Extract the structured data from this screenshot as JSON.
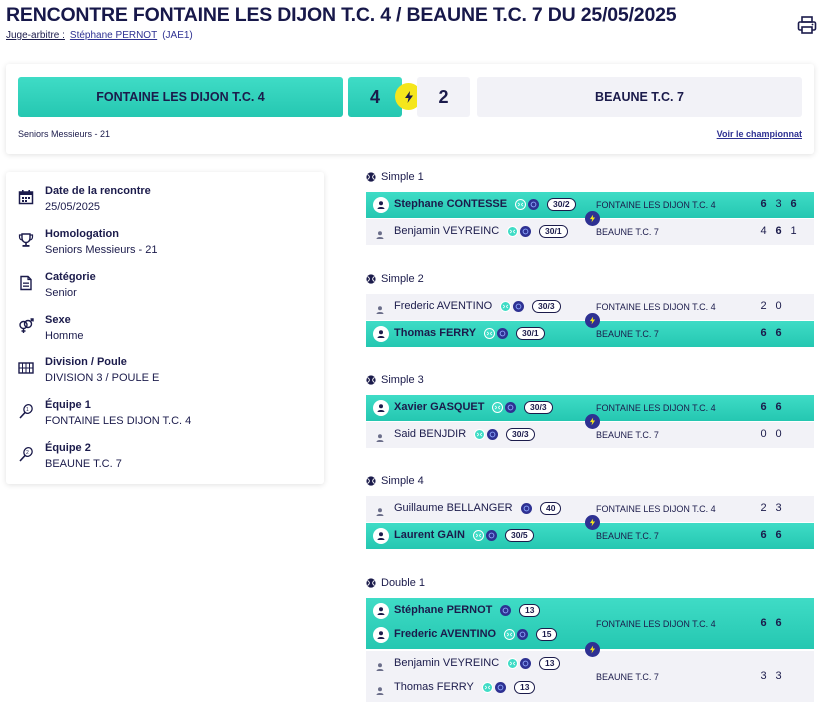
{
  "title": "RENCONTRE FONTAINE LES DIJON T.C. 4 / BEAUNE T.C. 7 DU 25/05/2025",
  "referee": {
    "label": "Juge-arbitre :",
    "name": "Stéphane PERNOT",
    "code": "(JAE1)"
  },
  "scoreboard": {
    "home_team": "FONTAINE LES DIJON T.C. 4",
    "away_team": "BEAUNE T.C. 7",
    "home_score": "4",
    "away_score": "2",
    "category": "Seniors Messieurs - 21",
    "championship_link": "Voir le championnat"
  },
  "info": [
    {
      "label": "Date de la rencontre",
      "value": "25/05/2025",
      "icon": "calendar-icon"
    },
    {
      "label": "Homologation",
      "value": "Seniors Messieurs - 21",
      "icon": "trophy-icon"
    },
    {
      "label": "Catégorie",
      "value": "Senior",
      "icon": "document-icon"
    },
    {
      "label": "Sexe",
      "value": "Homme",
      "icon": "gender-icon"
    },
    {
      "label": "Division / Poule",
      "value": "DIVISION 3 / POULE E",
      "icon": "grid-icon"
    },
    {
      "label": "Équipe 1",
      "value": "FONTAINE LES DIJON T.C. 4",
      "icon": "racket-1-icon"
    },
    {
      "label": "Équipe 2",
      "value": "BEAUNE T.C. 7",
      "icon": "racket-2-icon"
    }
  ],
  "matches": [
    {
      "title": "Simple 1",
      "rows": [
        {
          "winner": true,
          "players": [
            {
              "name": "Stephane CONTESSE",
              "rank": "30/2",
              "teal": true
            }
          ],
          "team": "FONTAINE LES DIJON T.C. 4",
          "sets": [
            {
              "v": "6",
              "w": true
            },
            {
              "v": "3",
              "w": false
            },
            {
              "v": "6",
              "w": true
            }
          ]
        },
        {
          "winner": false,
          "players": [
            {
              "name": "Benjamin VEYREINC",
              "rank": "30/1",
              "teal": true
            }
          ],
          "team": "BEAUNE T.C. 7",
          "sets": [
            {
              "v": "4",
              "w": false
            },
            {
              "v": "6",
              "w": true
            },
            {
              "v": "1",
              "w": false
            }
          ]
        }
      ]
    },
    {
      "title": "Simple 2",
      "rows": [
        {
          "winner": false,
          "players": [
            {
              "name": "Frederic AVENTINO",
              "rank": "30/3",
              "teal": true
            }
          ],
          "team": "FONTAINE LES DIJON T.C. 4",
          "sets": [
            {
              "v": "2",
              "w": false
            },
            {
              "v": "0",
              "w": false
            }
          ]
        },
        {
          "winner": true,
          "players": [
            {
              "name": "Thomas FERRY",
              "rank": "30/1",
              "teal": true
            }
          ],
          "team": "BEAUNE T.C. 7",
          "sets": [
            {
              "v": "6",
              "w": true
            },
            {
              "v": "6",
              "w": true
            }
          ]
        }
      ]
    },
    {
      "title": "Simple 3",
      "rows": [
        {
          "winner": true,
          "players": [
            {
              "name": "Xavier GASQUET",
              "rank": "30/3",
              "teal": true
            }
          ],
          "team": "FONTAINE LES DIJON T.C. 4",
          "sets": [
            {
              "v": "6",
              "w": true
            },
            {
              "v": "6",
              "w": true
            }
          ]
        },
        {
          "winner": false,
          "players": [
            {
              "name": "Said BENJDIR",
              "rank": "30/3",
              "teal": true
            }
          ],
          "team": "BEAUNE T.C. 7",
          "sets": [
            {
              "v": "0",
              "w": false
            },
            {
              "v": "0",
              "w": false
            }
          ]
        }
      ]
    },
    {
      "title": "Simple 4",
      "rows": [
        {
          "winner": false,
          "players": [
            {
              "name": "Guillaume BELLANGER",
              "rank": "40",
              "teal": false
            }
          ],
          "team": "FONTAINE LES DIJON T.C. 4",
          "sets": [
            {
              "v": "2",
              "w": false
            },
            {
              "v": "3",
              "w": false
            }
          ]
        },
        {
          "winner": true,
          "players": [
            {
              "name": "Laurent GAIN",
              "rank": "30/5",
              "teal": true
            }
          ],
          "team": "BEAUNE T.C. 7",
          "sets": [
            {
              "v": "6",
              "w": true
            },
            {
              "v": "6",
              "w": true
            }
          ]
        }
      ]
    },
    {
      "title": "Double 1",
      "rows": [
        {
          "winner": true,
          "players": [
            {
              "name": "Stéphane PERNOT",
              "rank": "13",
              "teal": false
            },
            {
              "name": "Frederic AVENTINO",
              "rank": "15",
              "teal": true
            }
          ],
          "team": "FONTAINE LES DIJON T.C. 4",
          "sets": [
            {
              "v": "6",
              "w": true
            },
            {
              "v": "6",
              "w": true
            }
          ]
        },
        {
          "winner": false,
          "players": [
            {
              "name": "Benjamin VEYREINC",
              "rank": "13",
              "teal": true
            },
            {
              "name": "Thomas FERRY",
              "rank": "13",
              "teal": true
            }
          ],
          "team": "BEAUNE T.C. 7",
          "sets": [
            {
              "v": "3",
              "w": false
            },
            {
              "v": "3",
              "w": false
            }
          ]
        }
      ]
    }
  ],
  "colors": {
    "teal": "#2dd4be",
    "navy": "#2e3192",
    "text": "#1b1b4b",
    "light": "#f2f2f7",
    "bolt": "#f5e61c"
  },
  "icons": {
    "print": "printer-icon",
    "bolt": "lightning-icon",
    "ball": "tennis-ball-icon",
    "user": "user-icon"
  }
}
